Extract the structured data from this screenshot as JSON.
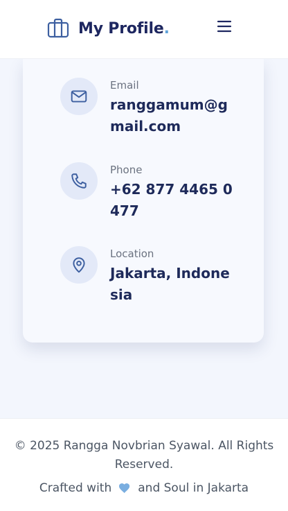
{
  "header": {
    "title": "My Profile",
    "title_dot": ".",
    "logo_icon": "briefcase-icon",
    "menu_icon": "hamburger-menu-icon"
  },
  "contacts": [
    {
      "icon": "mail-icon",
      "label": "Email",
      "value": "ranggamum@gmail.com"
    },
    {
      "icon": "phone-icon",
      "label": "Phone",
      "value": "+62 877 4465 0477"
    },
    {
      "icon": "map-pin-icon",
      "label": "Location",
      "value": "Jakarta, Indonesia"
    }
  ],
  "footer": {
    "copyright": "© 2025 Rangga Novbrian Syawal. All Rights Reserved.",
    "crafted_prefix": "Crafted with",
    "crafted_suffix": "and Soul in Jakarta",
    "heart_icon": "heart-icon"
  },
  "colors": {
    "primary": "#1e2760",
    "accent": "#5fa3d9",
    "icon_bg": "#e3e9f8",
    "page_bg": "#f3f6fd"
  }
}
